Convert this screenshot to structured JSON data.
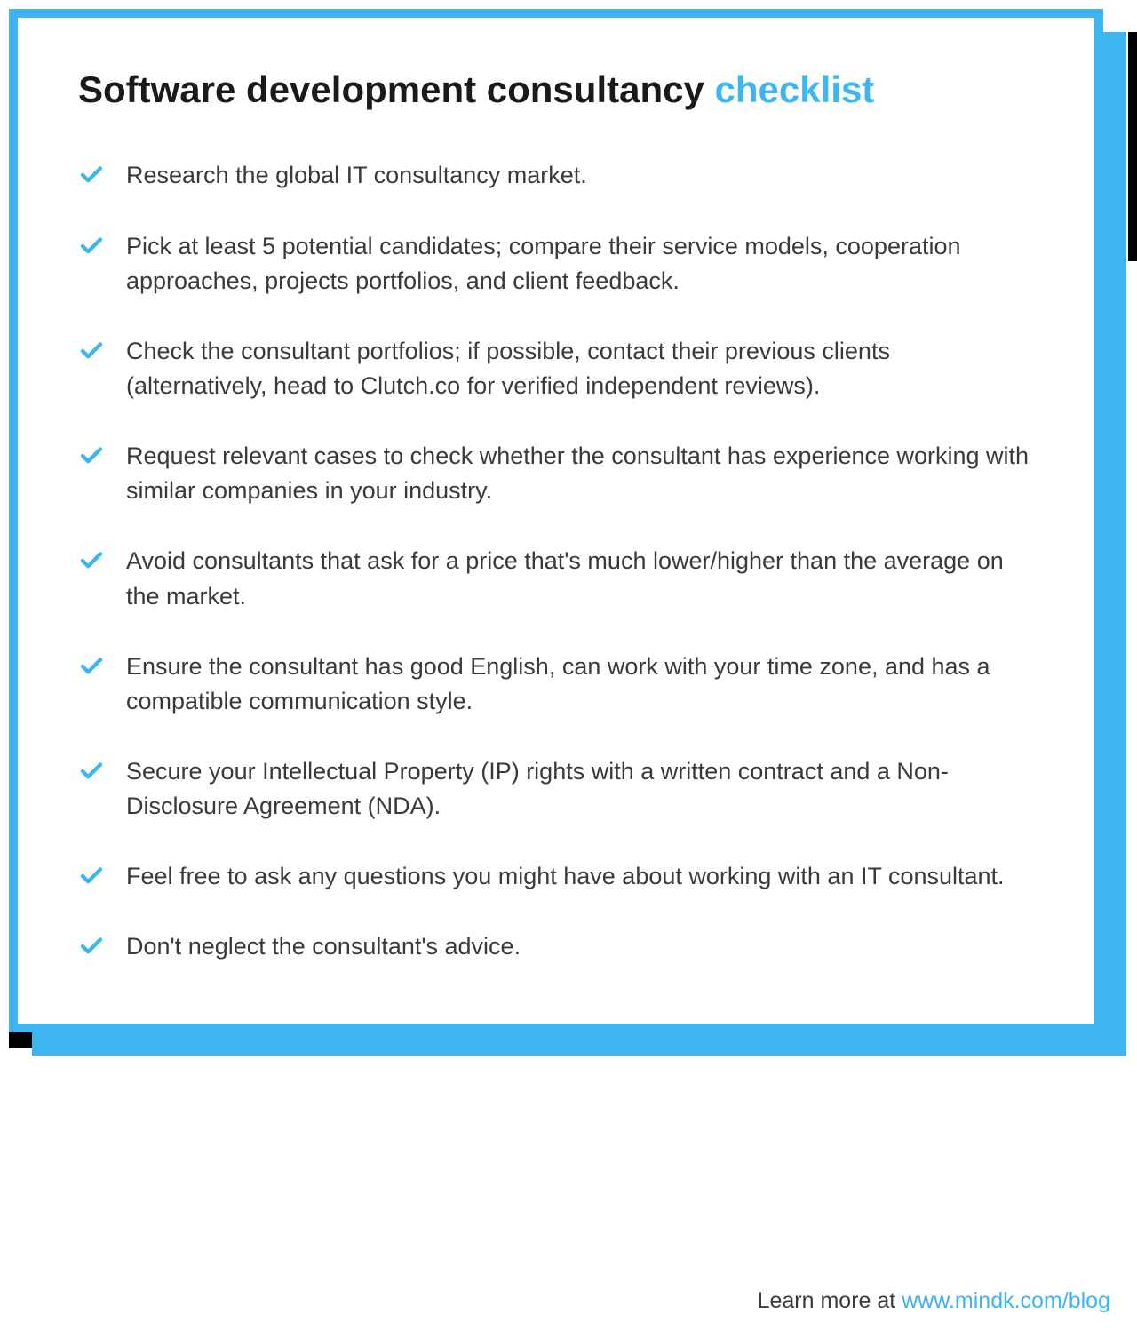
{
  "title_main": "Software development consultancy ",
  "title_highlight": "checklist",
  "items": [
    "Research the global IT consultancy market.",
    "Pick at least 5 potential candidates; compare their service models, cooperation approaches, projects portfolios, and client feedback.",
    "Check the consultant portfolios; if possible, contact their previous clients (alternatively, head to Clutch.co for verified independent reviews).",
    "Request relevant cases to check whether the consultant has experience working with similar companies in your industry.",
    "Avoid consultants that ask for a price that's much lower/higher than the average on the market.",
    "Ensure the consultant has good English, can work with your time zone, and has a compatible communication style.",
    "Secure your Intellectual Property (IP) rights with a written contract and a Non-Disclosure Agreement (NDA).",
    "Feel free to ask any questions you might have about working with an IT consultant.",
    "Don't neglect the consultant's advice."
  ],
  "footer_label": "Learn more at  ",
  "footer_link": "www.mindk.com/blog",
  "colors": {
    "accent": "#3db5ef",
    "text": "#1a1a1a",
    "body": "#3a3a3a"
  }
}
